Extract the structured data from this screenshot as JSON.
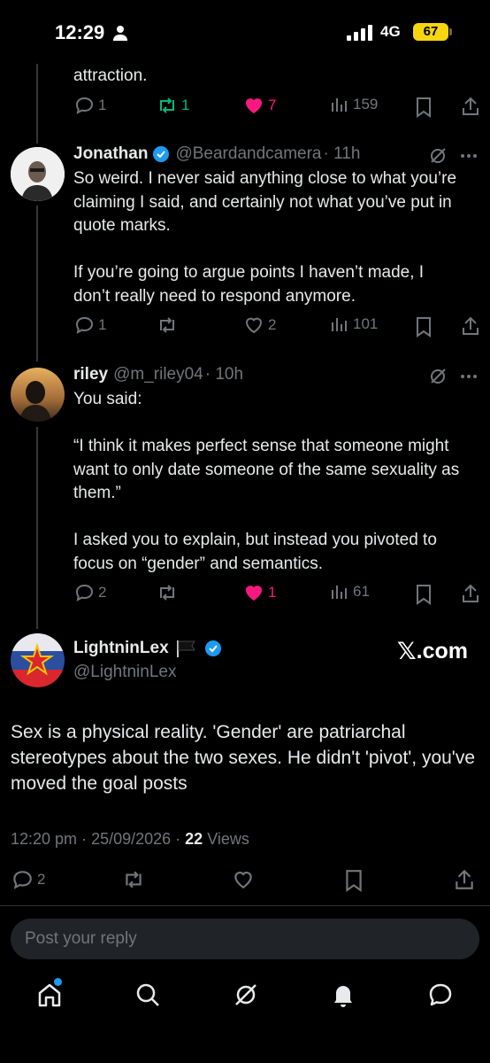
{
  "status_bar": {
    "time": "12:29",
    "network": "4G",
    "battery": "67"
  },
  "tweets": [
    {
      "text": "attraction.",
      "replies": "1",
      "reposts": "1",
      "likes": "7",
      "views": "159"
    },
    {
      "name": "Jonathan",
      "handle": "@Beardandcamera",
      "age": "· 11h",
      "text": "So weird. I never said anything close to what you’re claiming I said, and certainly not what you’ve put in quote marks.\n\nIf you’re going to argue points I haven’t made, I don’t really need to respond anymore.",
      "replies": "1",
      "reposts": "",
      "likes": "2",
      "views": "101"
    },
    {
      "name": "riley",
      "handle": "@m_riley04",
      "age": "· 10h",
      "text": "You said:\n\n“I think it makes perfect sense that someone might want to only date someone of the same sexuality as them.”\n\nI asked you to explain, but instead you pivoted to focus on “gender” and semantics.",
      "replies": "2",
      "reposts": "",
      "likes": "1",
      "views": "61"
    }
  ],
  "main_tweet": {
    "name": "LightninLex",
    "handle": "@LightninLex",
    "badge": "X.com",
    "text": "Sex is a physical reality. 'Gender' are patriarchal stereotypes about the two sexes. He didn't 'pivot', you've moved the goal posts",
    "time": "12:20 pm",
    "date": "25/09/2026",
    "views_count": "22",
    "views_label": "Views",
    "replies": "2"
  },
  "reply_placeholder": "Post your reply",
  "colors": {
    "verified": "#1d9bf0",
    "like": "#f91880",
    "repost": "#00ba7c",
    "muted": "#71767b"
  }
}
